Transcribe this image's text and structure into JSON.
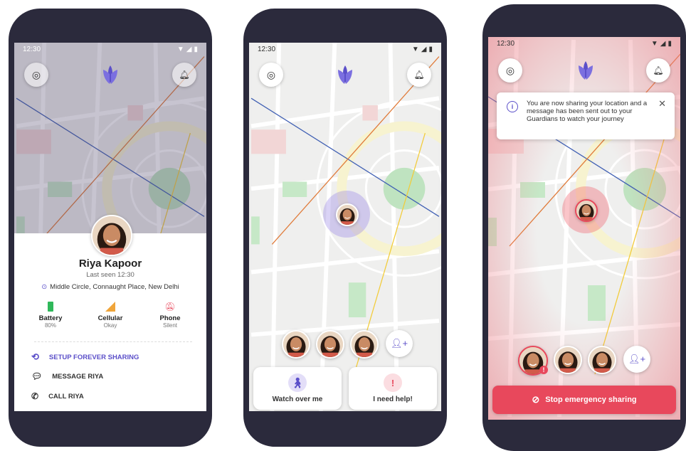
{
  "status_time": "12:30",
  "phone1": {
    "profile": {
      "name": "Riya Kapoor",
      "last_seen": "Last seen 12:30",
      "address": "Middle Circle, Connaught Place, New Delhi"
    },
    "stats": [
      {
        "title": "Battery",
        "value": "80%"
      },
      {
        "title": "Cellular",
        "value": "Okay"
      },
      {
        "title": "Phone",
        "value": "Silent"
      }
    ],
    "actions": [
      {
        "label": "SETUP FOREVER SHARING"
      },
      {
        "label": "MESSAGE RIYA"
      },
      {
        "label": "CALL RIYA"
      }
    ]
  },
  "phone2": {
    "buttons": {
      "watch_over_me": "Watch over me",
      "need_help": "I need help!"
    }
  },
  "phone3": {
    "toast": "You are now sharing your location and a message has been sent out to your Guardians to watch your journey",
    "stop_label": "Stop emergency sharing"
  },
  "colors": {
    "brand": "#5b4fc9",
    "danger": "#e8485c",
    "phone_frame": "#2b2a3c"
  }
}
